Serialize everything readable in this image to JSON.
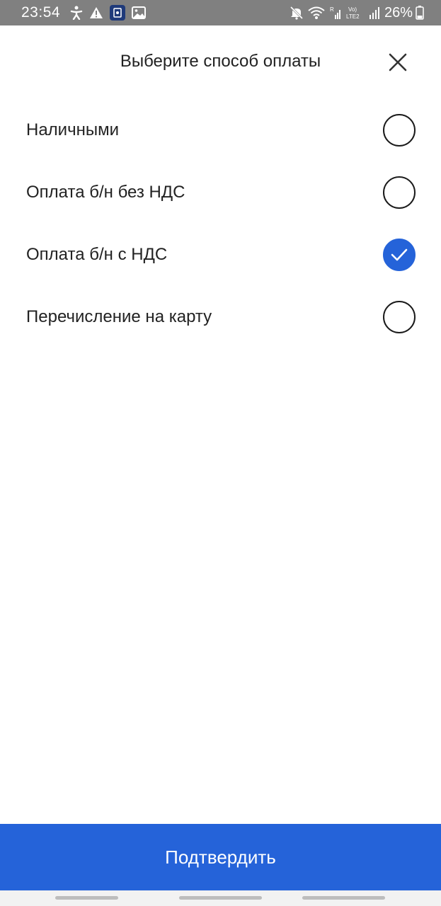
{
  "status_bar": {
    "time": "23:54",
    "battery_percent": "26%",
    "network_label": "LTE2",
    "icons_left": [
      "accessibility-icon",
      "warning-icon",
      "app-notification-icon",
      "image-icon"
    ],
    "icons_right": [
      "mute-icon",
      "wifi-icon",
      "signal-icon",
      "volte-icon",
      "signal-icon-2",
      "battery-icon"
    ]
  },
  "dialog": {
    "title": "Выберите способ оплаты",
    "close_icon": "close-icon"
  },
  "options": [
    {
      "label": "Наличными",
      "selected": false
    },
    {
      "label": "Оплата б/н без НДС",
      "selected": false
    },
    {
      "label": "Оплата б/н с НДС",
      "selected": true
    },
    {
      "label": "Перечисление на карту",
      "selected": false
    }
  ],
  "confirm_button": {
    "label": "Подтвердить"
  },
  "colors": {
    "accent": "#2563d9",
    "status_bar": "#808080",
    "text": "#222222"
  }
}
